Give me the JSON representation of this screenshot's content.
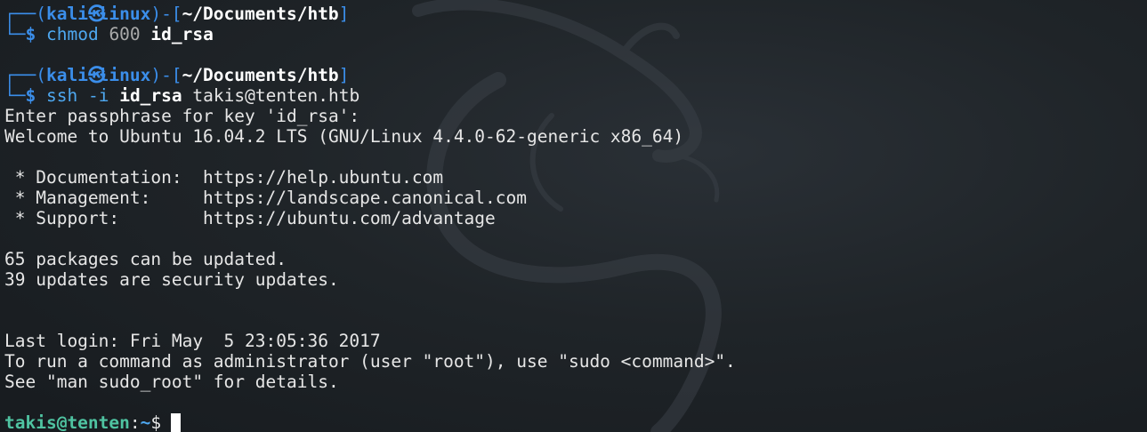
{
  "prompt": {
    "frame_top": "┌──(",
    "user": "kali",
    "glyph": "㉿",
    "host": "linux",
    "frame_mid": ")-[",
    "frame_end": "]",
    "frame_bottom": "└─",
    "symbol": "$"
  },
  "blocks": [
    {
      "cwd": "~/Documents/htb",
      "command": "chmod",
      "args": [
        {
          "text": "600",
          "style": "dim"
        },
        {
          "text": "id_rsa",
          "style": "bold"
        }
      ]
    },
    {
      "cwd": "~/Documents/htb",
      "command": "ssh",
      "args": [
        {
          "text": "-i",
          "style": "cmd"
        },
        {
          "text": "id_rsa",
          "style": "bold"
        },
        {
          "text": "takis@tenten.htb",
          "style": "plain"
        }
      ]
    }
  ],
  "output": {
    "passphrase": "Enter passphrase for key 'id_rsa':",
    "welcome": "Welcome to Ubuntu 16.04.2 LTS (GNU/Linux 4.4.0-62-generic x86_64)",
    "doc": " * Documentation:  https://help.ubuntu.com",
    "mgmt": " * Management:     https://landscape.canonical.com",
    "support": " * Support:        https://ubuntu.com/advantage",
    "packages": "65 packages can be updated.",
    "security": "39 updates are security updates.",
    "last_login": "Last login: Fri May  5 23:05:36 2017",
    "sudo_hint": "To run a command as administrator (user \"root\"), use \"sudo <command>\".",
    "see_man": "See \"man sudo_root\" for details."
  },
  "remote_prompt": {
    "user_host": "takis@tenten",
    "colon": ":",
    "path": "~",
    "dollar": "$"
  },
  "colors": {
    "background": "#1f2428",
    "prompt_blue": "#3b8eea",
    "remote_green": "#4fc3a1",
    "text": "#e6e6e6"
  },
  "background_icon": "kali-dragon-icon"
}
